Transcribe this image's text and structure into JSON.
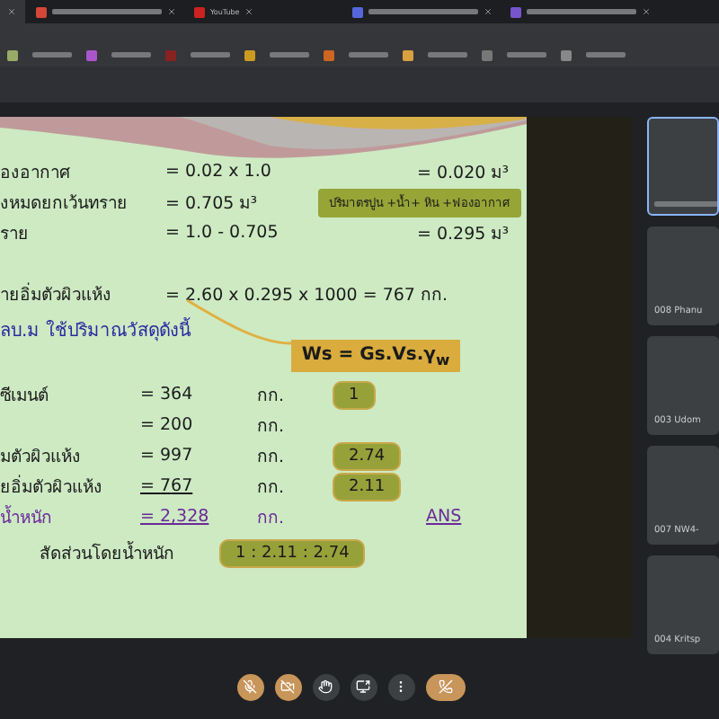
{
  "tabs": [
    {
      "selected": true
    },
    {
      "selected": false,
      "color": "#d44638"
    },
    {
      "selected": false,
      "color": "#cc2222",
      "title": "YouTube"
    },
    {
      "selected": false,
      "color": "#5566dd"
    },
    {
      "selected": false,
      "color": "#7755cc"
    }
  ],
  "slide": {
    "lines": [
      {
        "kind": "calc",
        "label": "องอากาศ",
        "expr": "=   0.02 x 1.0",
        "result": "=   0.020   ม³"
      },
      {
        "kind": "calc",
        "label": "งหมดยกเว้นทราย",
        "expr": "=   0.705   ม³",
        "note": "ปริมาตรปูน +น้ำ+ หิน +ฟองอากาศ"
      },
      {
        "kind": "calc",
        "label": "ราย",
        "expr": "=   1.0 - 0.705",
        "result": "=   0.295   ม³"
      },
      {
        "kind": "gap"
      },
      {
        "kind": "wide",
        "label": "ายอิ่มตัวผิวแห้ง",
        "expr": "=  2.60 x 0.295 x 1000 =   767 กก."
      }
    ],
    "formula": "Ws  =  Gs.Vs.γ$_{w}$",
    "heading": "ลบ.ม  ใช้ปริมาณวัสดุดังนี้",
    "materials": [
      {
        "label": "ซีเมนต์",
        "value": "=   364",
        "unit": "กก.",
        "ratio": "1",
        "underlined": false,
        "total": false
      },
      {
        "value": "=  200",
        "unit": "กก.",
        "underlined": false,
        "total": false
      },
      {
        "label": "มตัวผิวแห้ง",
        "value": "=   997",
        "unit": "กก.",
        "ratio": "2.74",
        "underlined": false,
        "total": false
      },
      {
        "label": "ยอิ่มตัวผิวแห้ง",
        "value": "=  767",
        "unit": "กก.",
        "ratio": "2.11",
        "underlined": true,
        "total": false
      },
      {
        "label": "น้ำหนัก",
        "value": "= 2,328",
        "unit": "กก.",
        "answer": "ANS",
        "underlined": true,
        "total": true
      }
    ],
    "ratio_label": "สัดส่วนโดยน้ำหนัก",
    "ratio_value": "1 : 2.11 : 2.74"
  },
  "participants": [
    {
      "selected": true
    },
    {
      "name": "008 Phanu",
      "selected": false
    },
    {
      "name": "003 Udom",
      "selected": false
    },
    {
      "name": "007 NW4-",
      "selected": false
    },
    {
      "name": "004 Kritsp",
      "selected": false
    }
  ],
  "controls": [
    {
      "kind": "mic",
      "highlighted": true
    },
    {
      "kind": "camera",
      "highlighted": true
    },
    {
      "kind": "reaction",
      "highlighted": false
    },
    {
      "kind": "share",
      "highlighted": false
    },
    {
      "kind": "more",
      "highlighted": false
    },
    {
      "kind": "leave",
      "highlighted": true
    }
  ]
}
